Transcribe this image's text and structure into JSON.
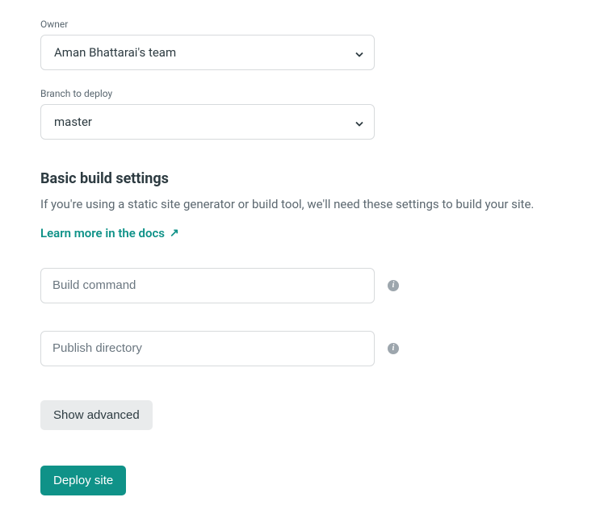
{
  "owner": {
    "label": "Owner",
    "value": "Aman Bhattarai's team"
  },
  "branch": {
    "label": "Branch to deploy",
    "value": "master"
  },
  "buildSettings": {
    "heading": "Basic build settings",
    "description": "If you're using a static site generator or build tool, we'll need these settings to build your site.",
    "docsLink": "Learn more in the docs",
    "buildCommand": {
      "placeholder": "Build command"
    },
    "publishDirectory": {
      "placeholder": "Publish directory"
    }
  },
  "buttons": {
    "showAdvanced": "Show advanced",
    "deploySite": "Deploy site"
  }
}
